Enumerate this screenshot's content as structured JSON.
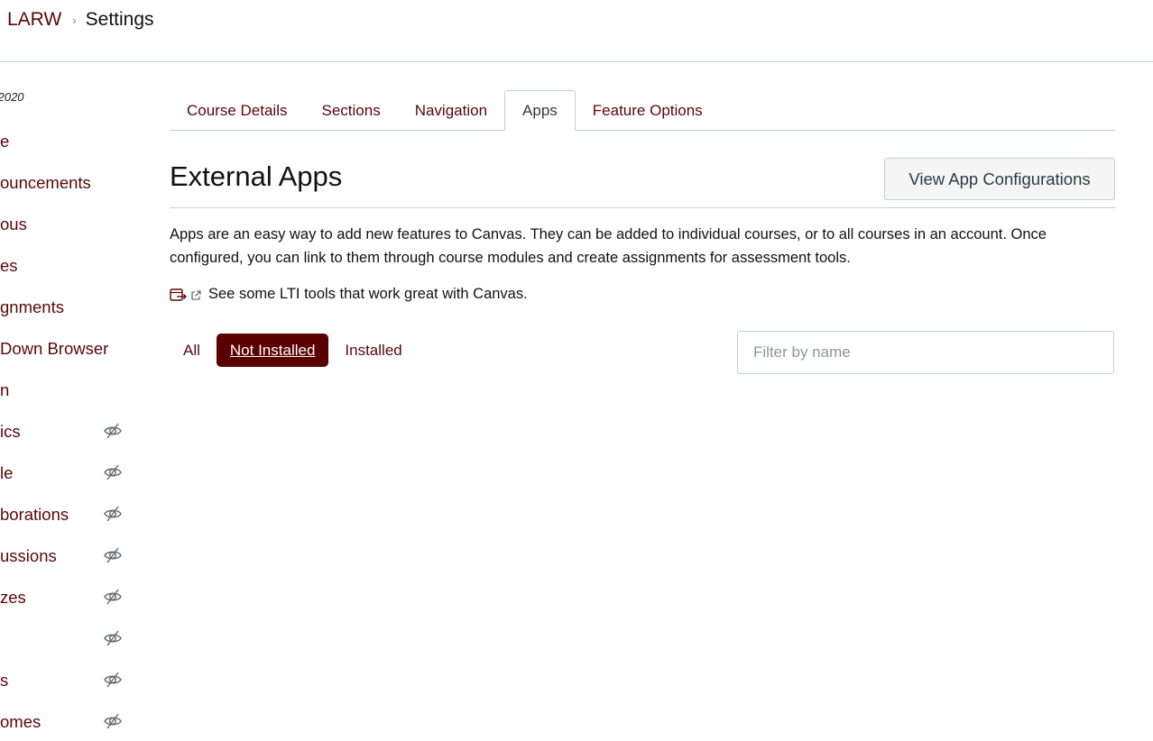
{
  "breadcrumb": {
    "course": "LARW",
    "separator": "›",
    "current": "Settings"
  },
  "sidebar": {
    "term": ".2020",
    "items": [
      {
        "label": "e",
        "hidden": false
      },
      {
        "label": "ouncements",
        "hidden": false
      },
      {
        "label": "ous",
        "hidden": false
      },
      {
        "label": "es",
        "hidden": false
      },
      {
        "label": "gnments",
        "hidden": false
      },
      {
        "label": "Down Browser",
        "hidden": false
      },
      {
        "label": "n",
        "hidden": false
      },
      {
        "label": "ics",
        "hidden": true
      },
      {
        "label": "le",
        "hidden": true
      },
      {
        "label": "borations",
        "hidden": true
      },
      {
        "label": "ussions",
        "hidden": true
      },
      {
        "label": "zes",
        "hidden": true
      },
      {
        "label": "",
        "hidden": true
      },
      {
        "label": "s",
        "hidden": true
      },
      {
        "label": "omes",
        "hidden": true
      }
    ],
    "hidden_icon": "eye-slash-icon"
  },
  "tabs": [
    {
      "label": "Course Details",
      "active": false
    },
    {
      "label": "Sections",
      "active": false
    },
    {
      "label": "Navigation",
      "active": false
    },
    {
      "label": "Apps",
      "active": true
    },
    {
      "label": "Feature Options",
      "active": false
    }
  ],
  "external_apps": {
    "title": "External Apps",
    "view_config_button": "View App Configurations",
    "description": "Apps are an easy way to add new features to Canvas. They can be added to individual courses, or to all courses in an account. Once configured, you can link to them through course modules and create assignments for assessment tools.",
    "lti_link": "See some LTI tools that work great with Canvas.",
    "filters": [
      {
        "label": "All",
        "active": false
      },
      {
        "label": "Not Installed",
        "active": true
      },
      {
        "label": "Installed",
        "active": false
      }
    ],
    "filter_input": {
      "value": "",
      "placeholder": "Filter by name"
    }
  },
  "colors": {
    "brand": "#5a0708",
    "active_filter_bg": "#5a0000",
    "border": "#c7cdd1"
  }
}
